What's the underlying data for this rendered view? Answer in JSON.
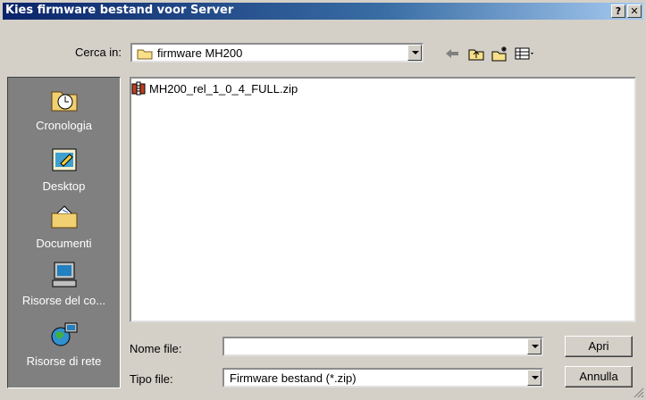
{
  "window": {
    "title": "Kies firmware bestand voor Server",
    "help_label": "?",
    "close_label": "✕"
  },
  "lookin": {
    "label": "Cerca in:",
    "value": "firmware MH200"
  },
  "toolbar": {
    "icons": [
      "back-arrow-icon",
      "up-folder-icon",
      "new-folder-icon",
      "view-menu-icon"
    ]
  },
  "places": [
    {
      "label": "Cronologia",
      "icon": "history-icon"
    },
    {
      "label": "Desktop",
      "icon": "desktop-icon"
    },
    {
      "label": "Documenti",
      "icon": "documents-icon"
    },
    {
      "label": "Risorse del co...",
      "icon": "my-computer-icon"
    },
    {
      "label": "Risorse di rete",
      "icon": "network-icon"
    }
  ],
  "files": [
    {
      "name": "MH200_rel_1_0_4_FULL.zip",
      "icon": "zip-file-icon"
    }
  ],
  "filename": {
    "label": "Nome file:",
    "value": ""
  },
  "filetype": {
    "label": "Tipo file:",
    "value": "Firmware bestand  (*.zip)"
  },
  "buttons": {
    "open": "Apri",
    "cancel": "Annulla"
  }
}
